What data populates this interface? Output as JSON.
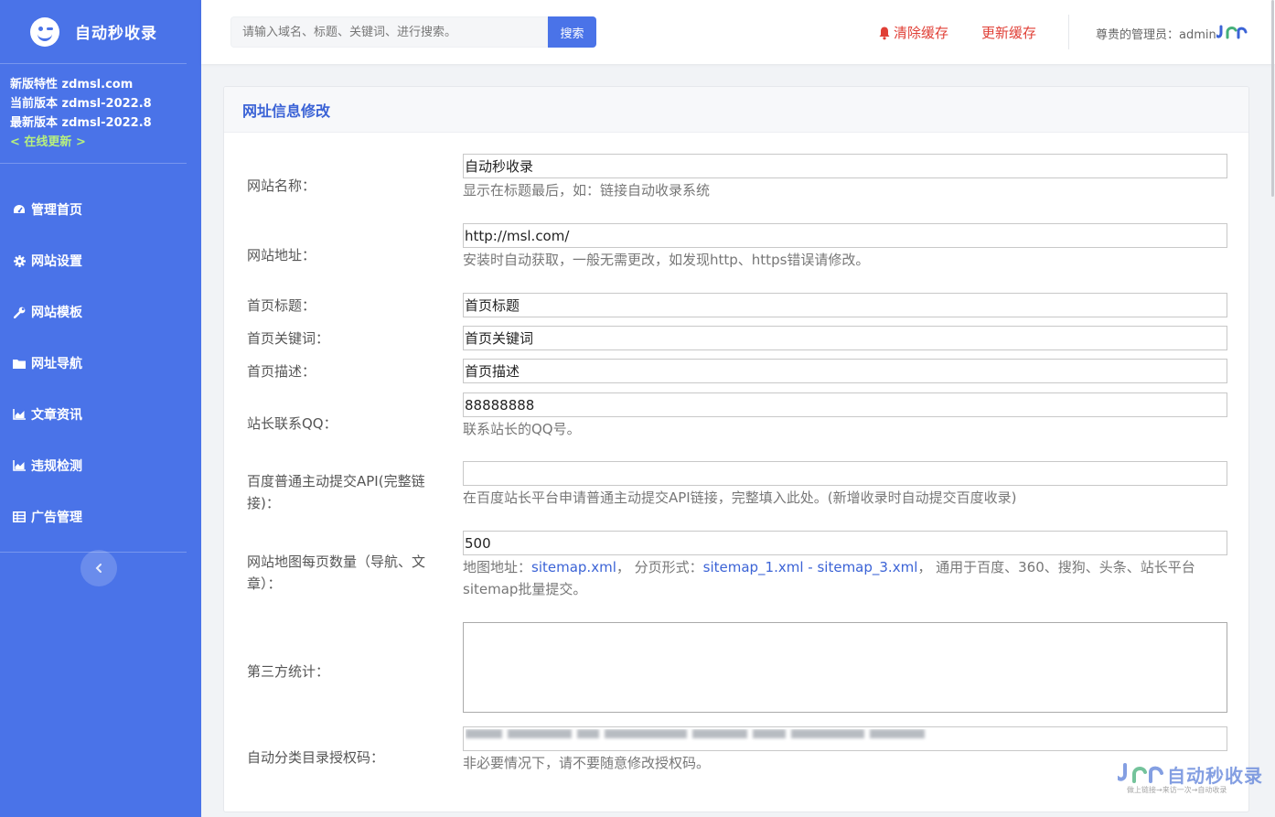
{
  "brand": {
    "name": "自动秒收录"
  },
  "version": {
    "new_features": "新版特性 zdmsl.com",
    "current": "当前版本 zdmsl-2022.8",
    "latest": "最新版本 zdmsl-2022.8",
    "update_link": "< 在线更新 >"
  },
  "nav": {
    "items": [
      {
        "label": "管理首页",
        "icon": "dashboard-icon"
      },
      {
        "label": "网站设置",
        "icon": "gear-icon"
      },
      {
        "label": "网站模板",
        "icon": "wrench-icon"
      },
      {
        "label": "网址导航",
        "icon": "folder-icon"
      },
      {
        "label": "文章资讯",
        "icon": "area-chart-icon"
      },
      {
        "label": "违规检测",
        "icon": "area-chart-icon"
      },
      {
        "label": "广告管理",
        "icon": "table-icon"
      }
    ]
  },
  "search": {
    "placeholder": "请输入域名、标题、关键词、进行搜索。",
    "button": "搜索"
  },
  "topbar": {
    "clear_cache": "清除缓存",
    "update_cache": "更新缓存",
    "admin_label": "尊贵的管理员：admin"
  },
  "card": {
    "title": "网址信息修改"
  },
  "form": {
    "site_name": {
      "label": "网站名称：",
      "value": "自动秒收录",
      "help": "显示在标题最后，如：链接自动收录系统"
    },
    "site_url": {
      "label": "网站地址：",
      "value": "http://msl.com/",
      "help": "安装时自动获取，一般无需更改，如发现http、https错误请修改。"
    },
    "home_title": {
      "label": "首页标题：",
      "value": "首页标题"
    },
    "home_keywords": {
      "label": "首页关键词：",
      "value": "首页关键词"
    },
    "home_desc": {
      "label": "首页描述：",
      "value": "首页描述"
    },
    "qq": {
      "label": "站长联系QQ：",
      "value": "88888888",
      "help": "联系站长的QQ号。"
    },
    "baidu_api": {
      "label": "百度普通主动提交API(完整链接)：",
      "value": "",
      "help": "在百度站长平台申请普通主动提交API链接，完整填入此处。(新增收录时自动提交百度收录)"
    },
    "sitemap": {
      "label": "网站地图每页数量（导航、文章）：",
      "value": "500",
      "help_prefix": "地图地址：",
      "link1": "sitemap.xml",
      "help_mid": "， 分页形式：",
      "link2": "sitemap_1.xml - sitemap_3.xml",
      "help_suffix": "， 通用于百度、360、搜狗、头条、站长平台sitemap批量提交。"
    },
    "stats": {
      "label": "第三方统计：",
      "value": ""
    },
    "auth_code": {
      "label": "自动分类目录授权码：",
      "help": "非必要情况下，请不要随意修改授权码。"
    }
  },
  "watermark": {
    "text": "自动秒收录",
    "sub": "做上链接→来访一次→自动收录"
  },
  "colors": {
    "sidebar": "#4a73e8",
    "accent": "#3b63d6",
    "danger": "#e03f36",
    "update_link": "#b7f07e"
  }
}
